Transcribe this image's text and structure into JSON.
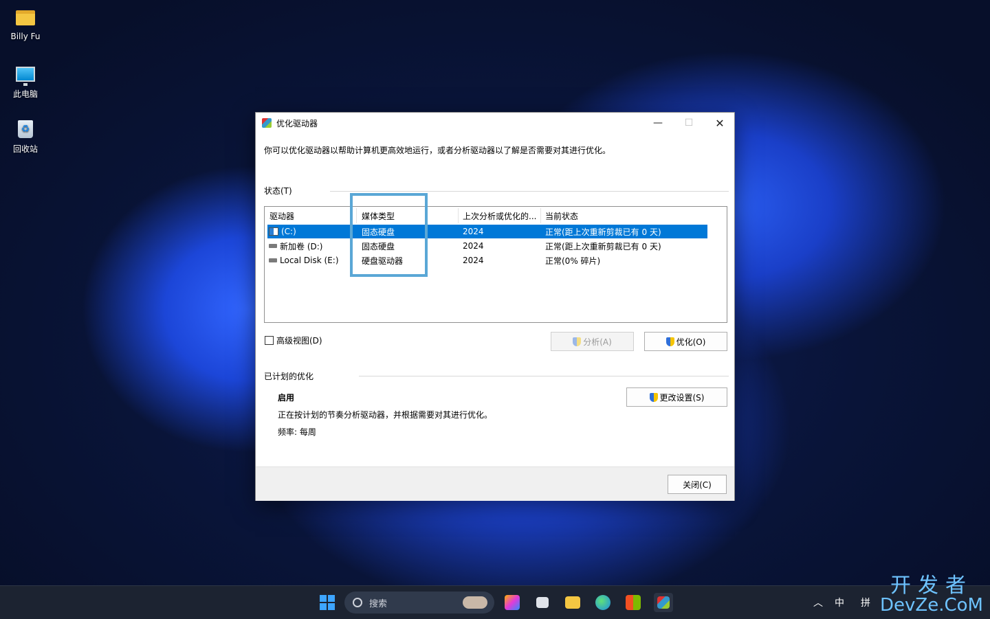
{
  "desktop": {
    "icons": [
      {
        "label": "Billy Fu"
      },
      {
        "label": "此电脑"
      },
      {
        "label": "回收站"
      }
    ]
  },
  "window": {
    "title": "优化驱动器",
    "intro": "你可以优化驱动器以帮助计算机更高效地运行，或者分析驱动器以了解是否需要对其进行优化。",
    "status_label": "状态(T)",
    "columns": [
      "驱动器",
      "媒体类型",
      "上次分析或优化的...",
      "当前状态"
    ],
    "drives": [
      {
        "name": "(C:)",
        "media": "固态硬盘",
        "last": "2024",
        "status": "正常(距上次重新剪裁已有 0 天)"
      },
      {
        "name": "新加卷 (D:)",
        "media": "固态硬盘",
        "last": "2024",
        "status": "正常(距上次重新剪裁已有 0 天)"
      },
      {
        "name": "Local Disk (E:)",
        "media": "硬盘驱动器",
        "last": "2024",
        "status": "正常(0% 碎片)"
      }
    ],
    "advanced_view": "高级视图(D)",
    "analyze_label": "分析(A)",
    "optimize_label": "优化(O)",
    "scheduled_label": "已计划的优化",
    "scheduled_state": "启用",
    "scheduled_desc": "正在按计划的节奏分析驱动器，并根据需要对其进行优化。",
    "frequency": "频率: 每周",
    "change_settings": "更改设置(S)",
    "close_label": "关闭(C)"
  },
  "taskbar": {
    "search_placeholder": "搜索",
    "tray_ime1": "中",
    "tray_ime2": "拼"
  },
  "watermark": {
    "line1": "开发者",
    "line2": "DevZe.CoM"
  },
  "colors": {
    "selection": "#0078d7",
    "highlight_box": "#5aa7d6"
  }
}
